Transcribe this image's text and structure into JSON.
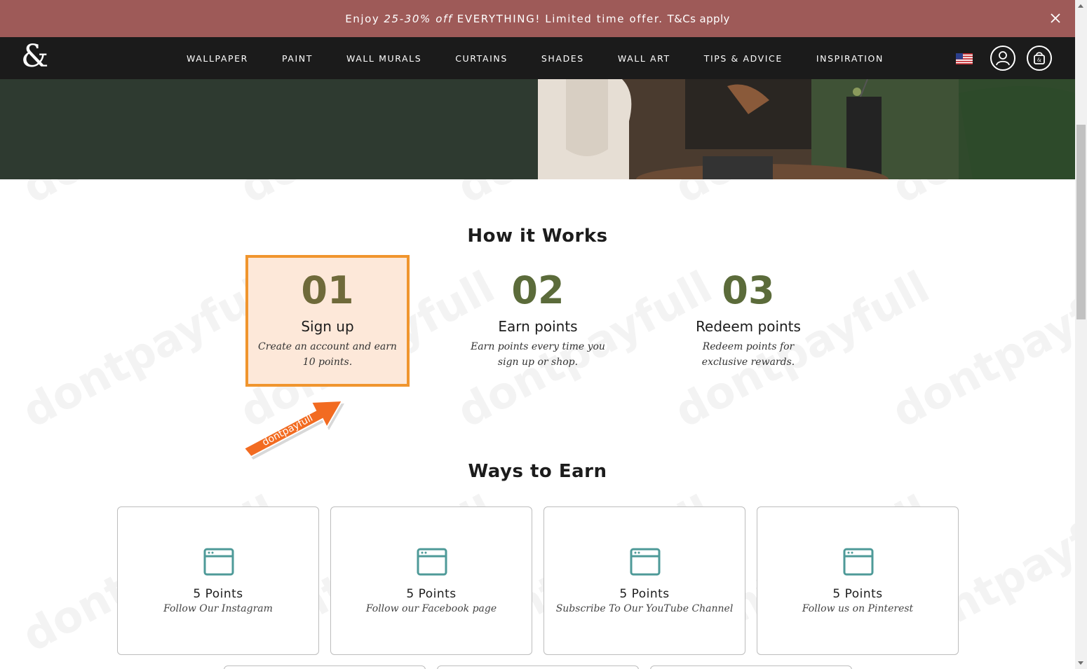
{
  "promo": {
    "text_before": "Enjoy",
    "discount": "25-30% off",
    "text_after": "EVERYTHING! Limited time offer.",
    "terms": "T&Cs apply"
  },
  "nav": {
    "logo": "&",
    "items": [
      {
        "label": "WALLPAPER"
      },
      {
        "label": "PAINT"
      },
      {
        "label": "WALL MURALS"
      },
      {
        "label": "CURTAINS"
      },
      {
        "label": "SHADES"
      },
      {
        "label": "WALL ART"
      },
      {
        "label": "TIPS & ADVICE"
      },
      {
        "label": "INSPIRATION"
      }
    ],
    "icons": [
      "us-flag-icon",
      "account-icon",
      "cart-icon"
    ]
  },
  "how_it_works": {
    "title": "How it Works",
    "steps": [
      {
        "number": "01",
        "title": "Sign up",
        "desc": "Create an account and earn 10 points."
      },
      {
        "number": "02",
        "title": "Earn points",
        "desc": "Earn points every time you sign up or shop."
      },
      {
        "number": "03",
        "title": "Redeem points",
        "desc": "Redeem points for exclusive rewards."
      }
    ]
  },
  "ways_to_earn": {
    "title": "Ways to Earn",
    "cards": [
      {
        "points": "5 Points",
        "desc": "Follow Our Instagram"
      },
      {
        "points": "5 Points",
        "desc": "Follow our Facebook page"
      },
      {
        "points": "5 Points",
        "desc": "Subscribe To Our YouTube Channel"
      },
      {
        "points": "5 Points",
        "desc": "Follow us on Pinterest"
      }
    ]
  },
  "watermark": {
    "text": "dontpayfull",
    "arrow_text": "dontpayfull"
  },
  "colors": {
    "promo_bg": "#9e5a58",
    "nav_bg": "#1b1b1b",
    "hero_green": "#2e3a30",
    "step_number": "#5b6b3a",
    "highlight_border": "#f0952e",
    "highlight_bg": "#fde8d9",
    "card_icon": "#4e9a98",
    "arrow": "#f26b21"
  }
}
